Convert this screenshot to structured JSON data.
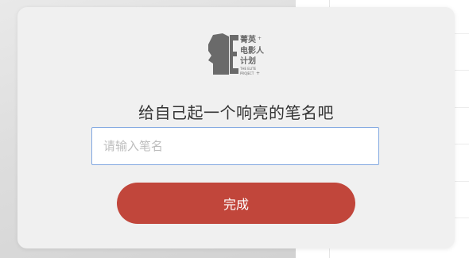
{
  "logo": {
    "line1": "菁英",
    "line2": "电影人",
    "line3": "计划",
    "line4": "THE ELITE",
    "line5": "PROJECT"
  },
  "dialog": {
    "title": "给自己起一个响亮的笔名吧",
    "input_placeholder": "请输入笔名",
    "input_value": "",
    "submit_label": "完成"
  },
  "colors": {
    "accent": "#c1463b",
    "input_border": "#82a8e0",
    "modal_bg": "#f0f0f0",
    "logo": "#6a6a6a"
  }
}
